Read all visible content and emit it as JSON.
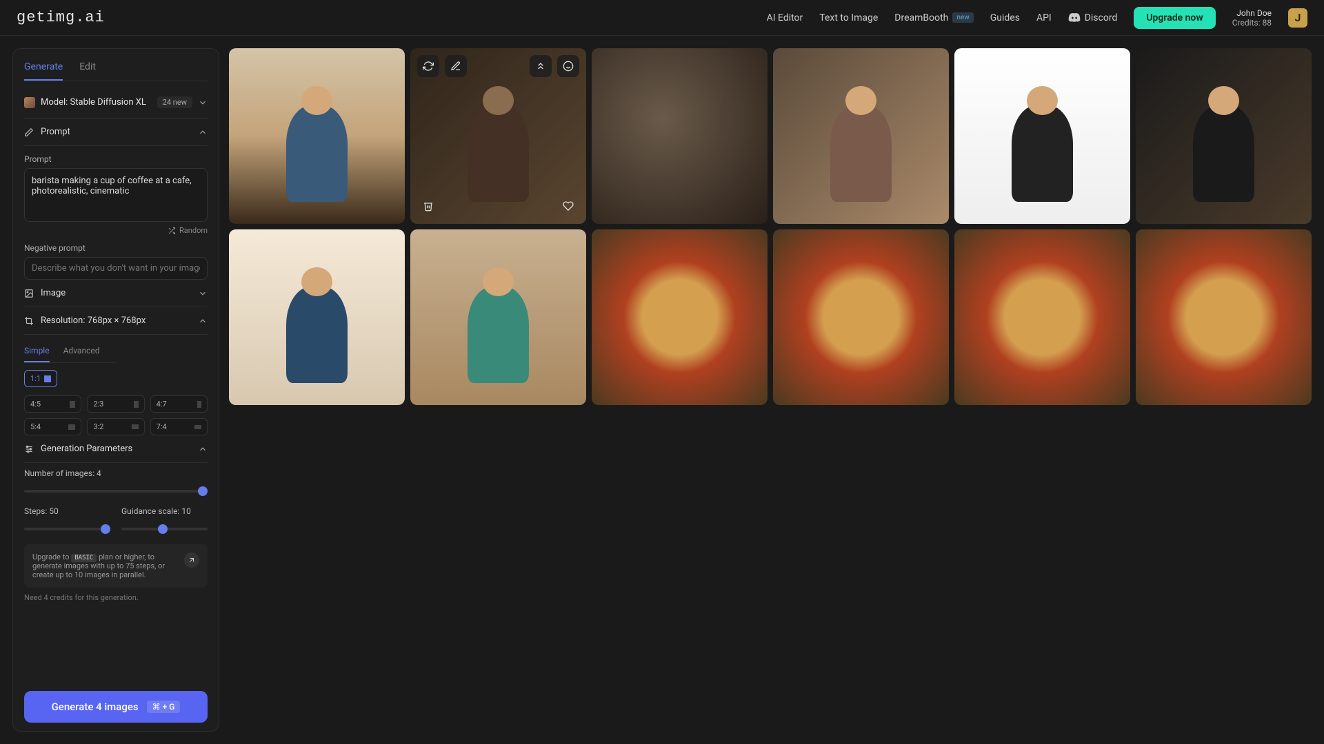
{
  "header": {
    "logo": "getimg.ai",
    "nav": {
      "ai_editor": "AI Editor",
      "text_to_image": "Text to Image",
      "dreambooth": "DreamBooth",
      "dreambooth_badge": "new",
      "guides": "Guides",
      "api": "API",
      "discord": "Discord",
      "upgrade": "Upgrade now"
    },
    "user": {
      "name": "John Doe",
      "credits_label": "Credits: 88",
      "initial": "J"
    }
  },
  "sidebar": {
    "tabs": {
      "generate": "Generate",
      "edit": "Edit"
    },
    "model": {
      "prefix": "Model:",
      "name": "Stable Diffusion XL",
      "badge": "24 new"
    },
    "sections": {
      "prompt": "Prompt",
      "image": "Image",
      "resolution": "Resolution: 768px × 768px",
      "gen_params": "Generation Parameters"
    },
    "prompt": {
      "label": "Prompt",
      "value": "barista making a cup of coffee at a cafe, photorealistic, cinematic",
      "random": "Random"
    },
    "negative": {
      "label": "Negative prompt",
      "placeholder": "Describe what you don't want in your image"
    },
    "res_tabs": {
      "simple": "Simple",
      "advanced": "Advanced"
    },
    "ratios": [
      "1:1",
      "4:5",
      "2:3",
      "4:7",
      "5:4",
      "3:2",
      "7:4"
    ],
    "num_images": {
      "label": "Number of images: 4",
      "value": 4,
      "max": 10
    },
    "steps": {
      "label": "Steps: 50",
      "value": 50,
      "max": 75
    },
    "guidance": {
      "label": "Guidance scale: 10",
      "value": 10,
      "max": 20
    },
    "upgrade_hint": {
      "prefix": "Upgrade to ",
      "plan": "BASIC",
      "rest": " plan or higher, to generate images with up to 75 steps, or create up to 10 images in parallel."
    },
    "credit_note": "Need 4 credits for this generation.",
    "generate_btn": "Generate 4 images",
    "generate_kbd": "⌘ + G"
  },
  "gallery": {
    "images": [
      {
        "id": "barista-sign",
        "desc": "barista illustration with sign"
      },
      {
        "id": "barista-photo-pour",
        "desc": "barista pouring photo",
        "hovered": true
      },
      {
        "id": "espresso-machine",
        "desc": "espresso machine closeup"
      },
      {
        "id": "barista-beard",
        "desc": "bearded barista pouring"
      },
      {
        "id": "barista-lineart",
        "desc": "line art barista"
      },
      {
        "id": "barista-ink",
        "desc": "ink style barista"
      },
      {
        "id": "barista-vector",
        "desc": "vector barista side"
      },
      {
        "id": "barista-flat",
        "desc": "flat illustration barista"
      },
      {
        "id": "pizza-top",
        "desc": "pizza top view"
      },
      {
        "id": "pizza-board",
        "desc": "pizza on board"
      },
      {
        "id": "pizza-slice",
        "desc": "pizza with ingredients"
      },
      {
        "id": "pizza-spread",
        "desc": "multiple pizzas"
      }
    ]
  }
}
